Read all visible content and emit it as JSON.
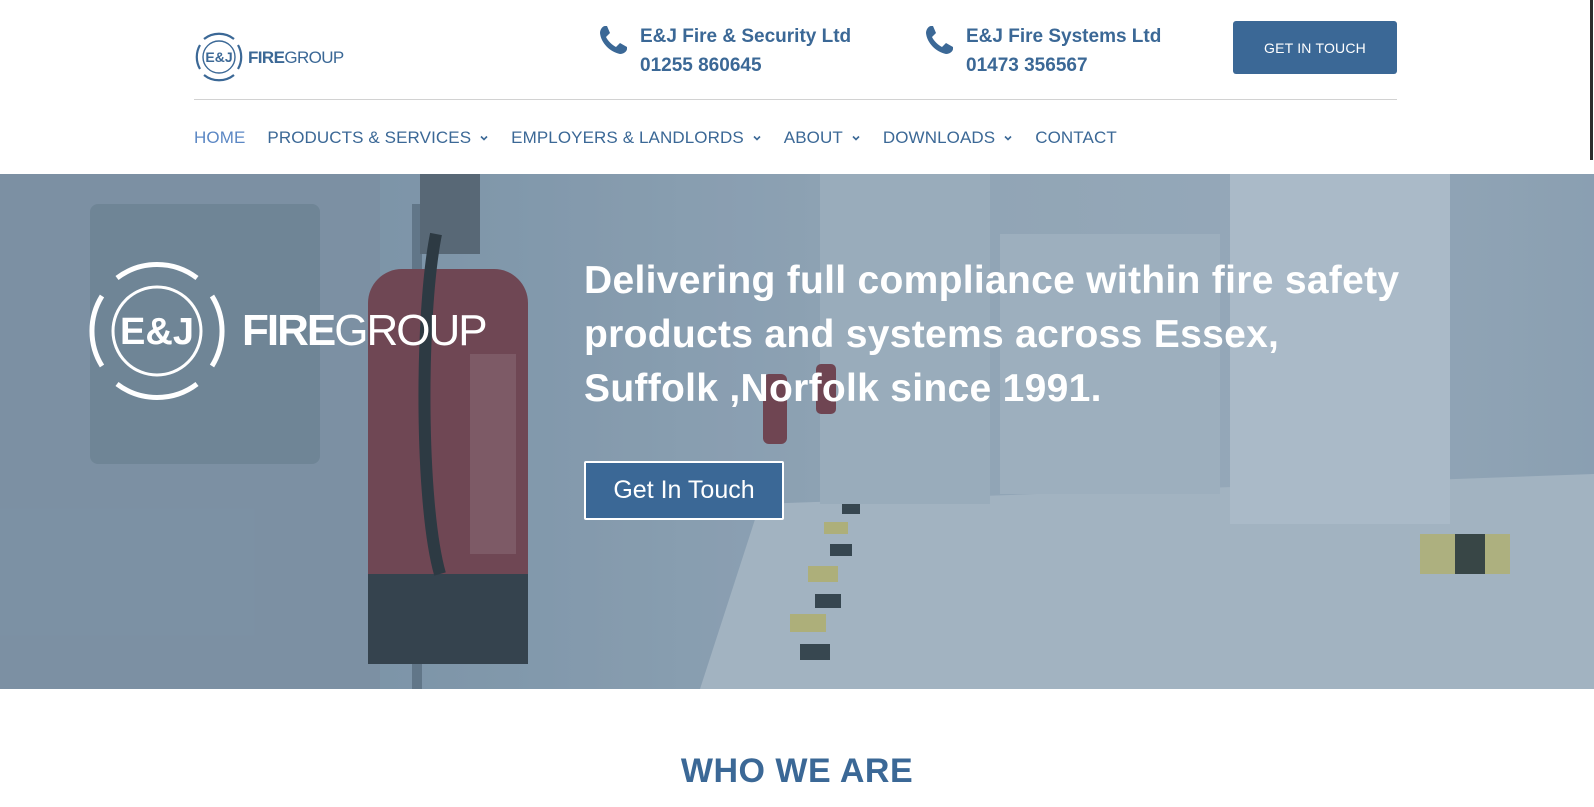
{
  "brand": {
    "logo_word_fire": "FIRE",
    "logo_word_group": "GROUP",
    "logo_monogram": "E&J"
  },
  "header": {
    "contacts": [
      {
        "company": "E&J Fire & Security Ltd",
        "phone": "01255 860645",
        "icon": "phone-icon"
      },
      {
        "company": "E&J Fire Systems Ltd",
        "phone": "01473 356567",
        "icon": "phone-icon"
      }
    ],
    "cta_label": "GET IN TOUCH"
  },
  "nav": {
    "items": [
      {
        "label": "HOME",
        "active": true,
        "has_dropdown": false
      },
      {
        "label": "PRODUCTS & SERVICES",
        "active": false,
        "has_dropdown": true
      },
      {
        "label": "EMPLOYERS & LANDLORDS",
        "active": false,
        "has_dropdown": true
      },
      {
        "label": "ABOUT",
        "active": false,
        "has_dropdown": true
      },
      {
        "label": "DOWNLOADS",
        "active": false,
        "has_dropdown": true
      },
      {
        "label": "CONTACT",
        "active": false,
        "has_dropdown": false
      }
    ]
  },
  "hero": {
    "heading": "Delivering full compliance within fire safety products and systems across Essex, Suffolk ,Norfolk since 1991.",
    "cta_label": "Get In Touch"
  },
  "section": {
    "title": "WHO WE ARE"
  },
  "colors": {
    "brand_blue": "#3b6896",
    "active_nav": "#5b87c4",
    "white": "#ffffff"
  }
}
